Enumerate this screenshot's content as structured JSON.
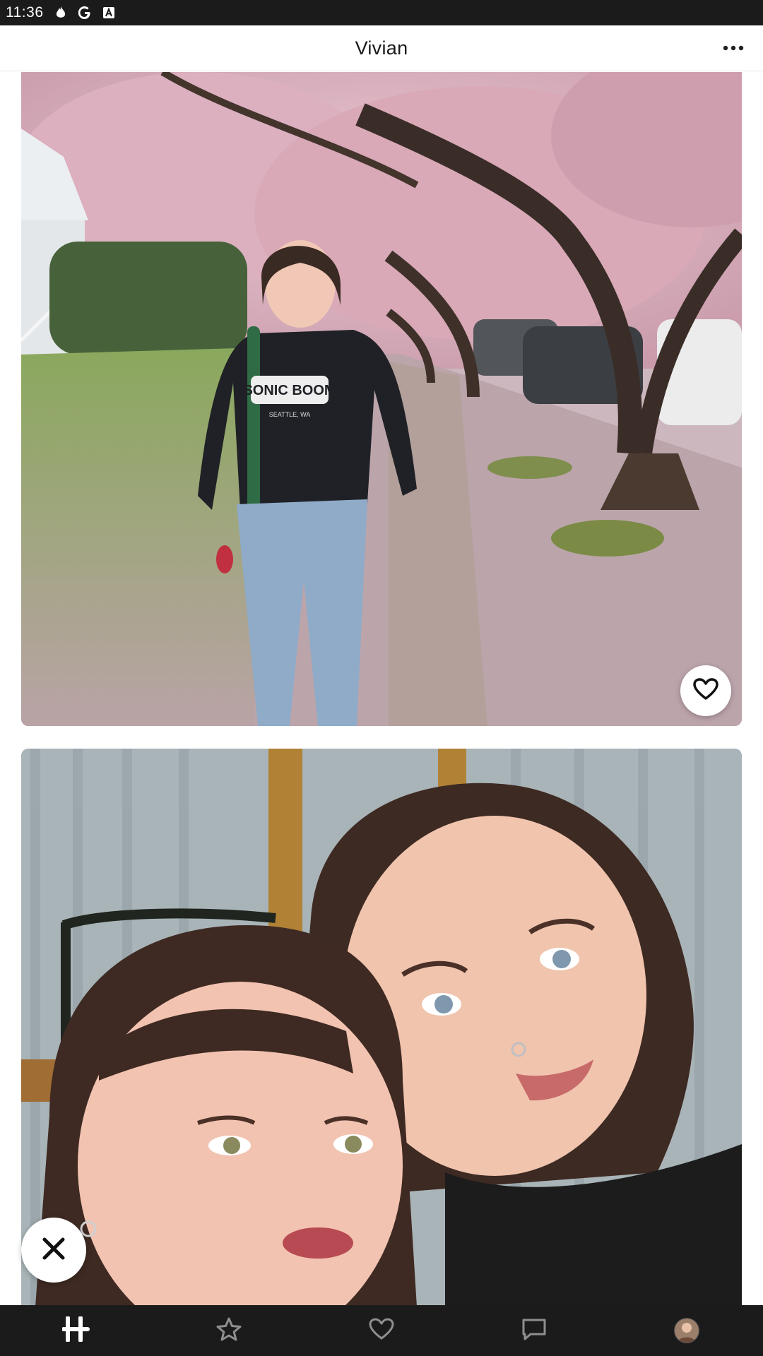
{
  "status_bar": {
    "time": "11:36",
    "icons": [
      "flame-icon",
      "google-icon",
      "keyboard-a-icon"
    ]
  },
  "header": {
    "title": "Vivian",
    "more_icon": "more-horizontal-icon"
  },
  "photos": [
    {
      "icon_like": "heart-icon"
    },
    {
      "icon_skip": "close-x-icon"
    }
  ],
  "shirt_print": {
    "line1": "SONIC BOOM",
    "line2": "SEATTLE, WA"
  },
  "tab_bar": {
    "tabs": [
      "hinge-home-icon",
      "star-icon",
      "heart-icon",
      "chat-icon",
      "profile-avatar"
    ]
  },
  "colors": {
    "status_bar_bg": "#1b1b1b",
    "tab_bar_bg": "#1b1b1b",
    "header_bg": "#ffffff",
    "blossom_pink": "#d7a9b7"
  }
}
